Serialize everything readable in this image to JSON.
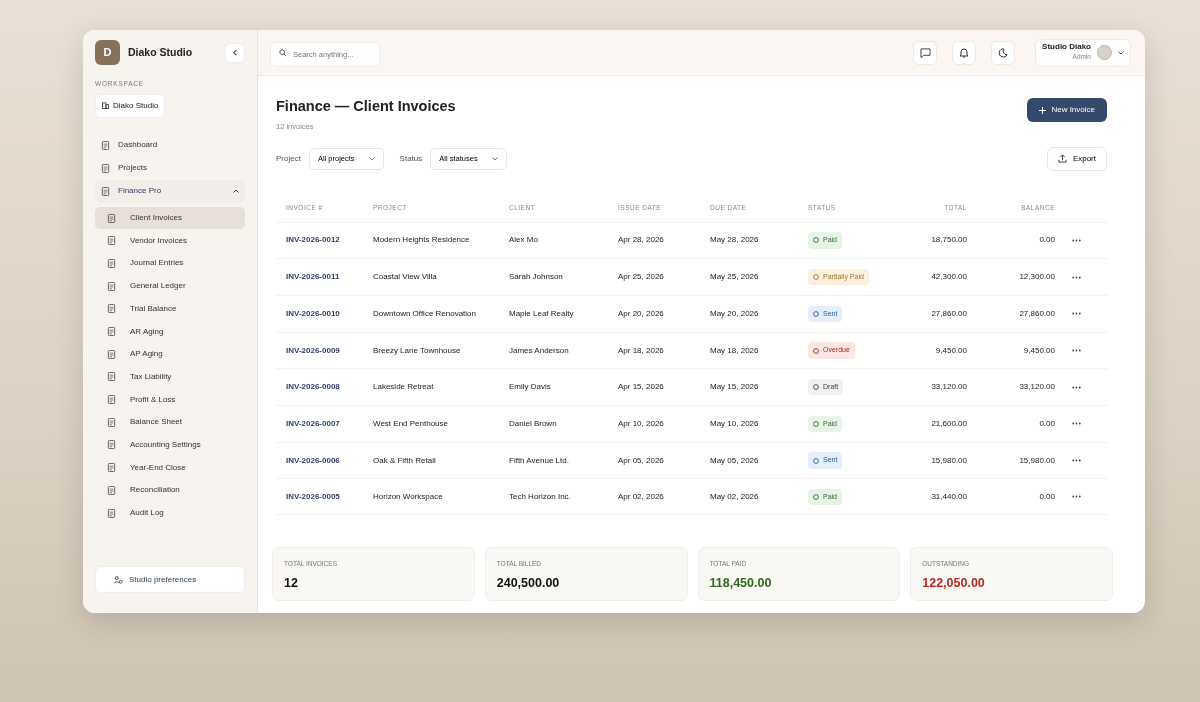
{
  "brand": {
    "initial": "D",
    "name": "Diako Studio"
  },
  "workspace": {
    "label": "WORKSPACE",
    "name": "Diako Studio"
  },
  "nav": [
    {
      "label": "Dashboard",
      "selected": false
    },
    {
      "label": "Projects",
      "selected": false
    },
    {
      "label": "Finance Pro",
      "selected": false,
      "expanded": true,
      "children": [
        {
          "label": "Client Invoices",
          "selected": true
        },
        {
          "label": "Vendor Invoices",
          "selected": false
        },
        {
          "label": "Journal Entries",
          "selected": false
        },
        {
          "label": "General Ledger",
          "selected": false
        },
        {
          "label": "Trial Balance",
          "selected": false
        },
        {
          "label": "AR Aging",
          "selected": false
        },
        {
          "label": "AP Aging",
          "selected": false
        },
        {
          "label": "Tax Liability",
          "selected": false
        },
        {
          "label": "Profit & Loss",
          "selected": false
        },
        {
          "label": "Balance Sheet",
          "selected": false
        },
        {
          "label": "Accounting Settings",
          "selected": false
        },
        {
          "label": "Year-End Close",
          "selected": false
        },
        {
          "label": "Reconciliation",
          "selected": false
        },
        {
          "label": "Audit Log",
          "selected": false
        }
      ]
    }
  ],
  "preferences": "Studio preferences",
  "search": {
    "placeholder": "Search anything..."
  },
  "user": {
    "name": "Studio Diako",
    "role": "Admin"
  },
  "page": {
    "title": "Finance — Client Invoices",
    "subtitle": "12 invoices",
    "new_button": "New Invoice",
    "export_button": "Export"
  },
  "filters": [
    {
      "label": "Project",
      "value": "All projects"
    },
    {
      "label": "Status",
      "value": "All statuses"
    }
  ],
  "table": {
    "columns": [
      "INVOICE #",
      "PROJECT",
      "CLIENT",
      "ISSUE DATE",
      "DUE DATE",
      "STATUS",
      "TOTAL",
      "BALANCE"
    ],
    "rows": [
      {
        "invoice": "INV-2026-0012",
        "project": "Modern Heights Residence",
        "client": "Alex Mo",
        "issue": "Apr 28, 2026",
        "due": "May 28, 2026",
        "status": "Paid",
        "kind": "paid",
        "total": "18,750.00",
        "balance": "0.00"
      },
      {
        "invoice": "INV-2026-0011",
        "project": "Coastal View Villa",
        "client": "Sarah Johnson",
        "issue": "Apr 25, 2026",
        "due": "May 25, 2026",
        "status": "Partially Paid",
        "kind": "partial",
        "total": "42,300.00",
        "balance": "12,300.00"
      },
      {
        "invoice": "INV-2026-0010",
        "project": "Downtown Office Renovation",
        "client": "Maple Leaf Realty",
        "issue": "Apr 20, 2026",
        "due": "May 20, 2026",
        "status": "Sent",
        "kind": "sent",
        "total": "27,860.00",
        "balance": "27,860.00"
      },
      {
        "invoice": "INV-2026-0009",
        "project": "Breezy Lane Townhouse",
        "client": "James Anderson",
        "issue": "Apr 18, 2026",
        "due": "May 18, 2026",
        "status": "Overdue",
        "kind": "overdue",
        "total": "9,450.00",
        "balance": "9,450.00"
      },
      {
        "invoice": "INV-2026-0008",
        "project": "Lakeside Retreat",
        "client": "Emily Davis",
        "issue": "Apr 15, 2026",
        "due": "May 15, 2026",
        "status": "Draft",
        "kind": "draft",
        "total": "33,120.00",
        "balance": "33,120.00"
      },
      {
        "invoice": "INV-2026-0007",
        "project": "West End Penthouse",
        "client": "Daniel Brown",
        "issue": "Apr 10, 2026",
        "due": "May 10, 2026",
        "status": "Paid",
        "kind": "paid",
        "total": "21,600.00",
        "balance": "0.00"
      },
      {
        "invoice": "INV-2026-0006",
        "project": "Oak & Fifth Retail",
        "client": "Fifth Avenue Ltd.",
        "issue": "Apr 05, 2026",
        "due": "May 05, 2026",
        "status": "Sent",
        "kind": "sent",
        "total": "15,980.00",
        "balance": "15,980.00"
      },
      {
        "invoice": "INV-2026-0005",
        "project": "Horizon Workspace",
        "client": "Tech Horizon Inc.",
        "issue": "Apr 02, 2026",
        "due": "May 02, 2026",
        "status": "Paid",
        "kind": "paid",
        "total": "31,440.00",
        "balance": "0.00"
      }
    ]
  },
  "summary": [
    {
      "label": "TOTAL INVOICES",
      "value": "12",
      "kind": "plain"
    },
    {
      "label": "TOTAL BILLED",
      "value": "240,500.00",
      "kind": "plain"
    },
    {
      "label": "TOTAL PAID",
      "value": "118,450.00",
      "kind": "positive"
    },
    {
      "label": "OUTSTANDING",
      "value": "122,050.00",
      "kind": "negative"
    }
  ]
}
